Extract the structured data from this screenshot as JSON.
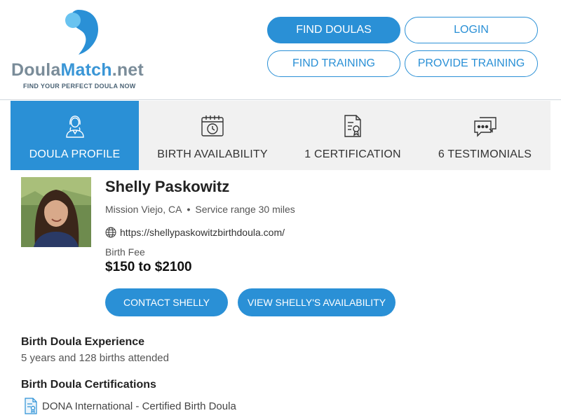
{
  "brand": {
    "name_part1": "Doula",
    "name_part2": "Match",
    "name_part3": ".net",
    "tagline": "FIND YOUR PERFECT DOULA NOW",
    "colors": {
      "blue": "#2a90d6",
      "gray": "#7a8c99"
    }
  },
  "nav": {
    "find_doulas": "FIND DOULAS",
    "login": "LOGIN",
    "find_training": "FIND TRAINING",
    "provide_training": "PROVIDE TRAINING"
  },
  "tabs": [
    {
      "label": "DOULA PROFILE",
      "icon": "doula-profile-icon",
      "active": true
    },
    {
      "label": "BIRTH AVAILABILITY",
      "icon": "calendar-clock-icon",
      "active": false
    },
    {
      "label": "1 CERTIFICATION",
      "icon": "certificate-icon",
      "active": false
    },
    {
      "label": "6 TESTIMONIALS",
      "icon": "chat-bubbles-icon",
      "active": false
    }
  ],
  "profile": {
    "name": "Shelly Paskowitz",
    "location": "Mission Viejo, CA",
    "service_range": "Service range 30 miles",
    "website": "https://shellypaskowitzbirthdoula.com/",
    "fee_label": "Birth Fee",
    "fee": "$150 to $2100",
    "contact_label": "CONTACT SHELLY",
    "availability_label": "VIEW SHELLY'S AVAILABILITY"
  },
  "experience": {
    "title": "Birth Doula Experience",
    "text": "5 years and 128 births attended"
  },
  "certifications": {
    "title": "Birth Doula Certifications",
    "items": [
      "DONA International - Certified Birth Doula"
    ]
  }
}
